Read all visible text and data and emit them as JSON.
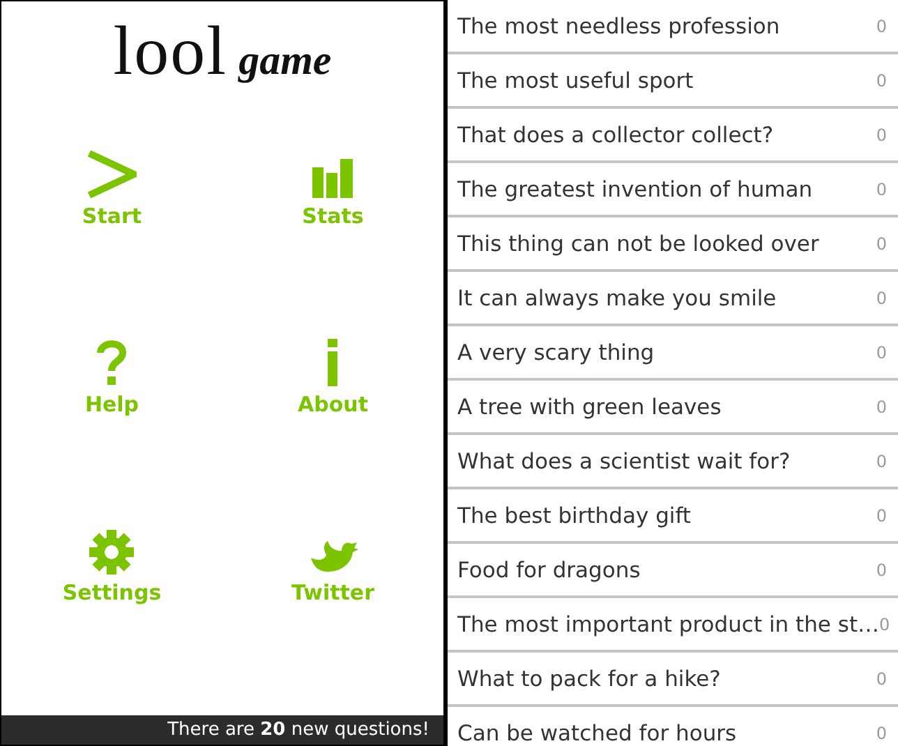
{
  "logo": {
    "word": "lool",
    "suffix": "game"
  },
  "menu": [
    {
      "kind": "start",
      "label": "Start"
    },
    {
      "kind": "stats",
      "label": "Stats"
    },
    {
      "kind": "help",
      "label": "Help"
    },
    {
      "kind": "about",
      "label": "About"
    },
    {
      "kind": "settings",
      "label": "Settings"
    },
    {
      "kind": "twitter",
      "label": "Twitter"
    }
  ],
  "status_bar": "There are **20** new questions!",
  "questions": [
    {
      "text": "The most needless profession",
      "count": "0"
    },
    {
      "text": "The most useful sport",
      "count": "0"
    },
    {
      "text": "That does a collector collect?",
      "count": "0"
    },
    {
      "text": "The greatest invention of human",
      "count": "0"
    },
    {
      "text": "This thing can not be looked over",
      "count": "0"
    },
    {
      "text": "It can always make you smile",
      "count": "0"
    },
    {
      "text": "A very scary thing",
      "count": "0"
    },
    {
      "text": "A tree with green leaves",
      "count": "0"
    },
    {
      "text": "What does a scientist wait for?",
      "count": "0"
    },
    {
      "text": "The best birthday gift",
      "count": "0"
    },
    {
      "text": "Food for dragons",
      "count": "0"
    },
    {
      "text": "The most important product in the st…",
      "count": "0"
    },
    {
      "text": "What to pack for a hike?",
      "count": "0"
    },
    {
      "text": "Can be watched for hours",
      "count": "0"
    }
  ]
}
